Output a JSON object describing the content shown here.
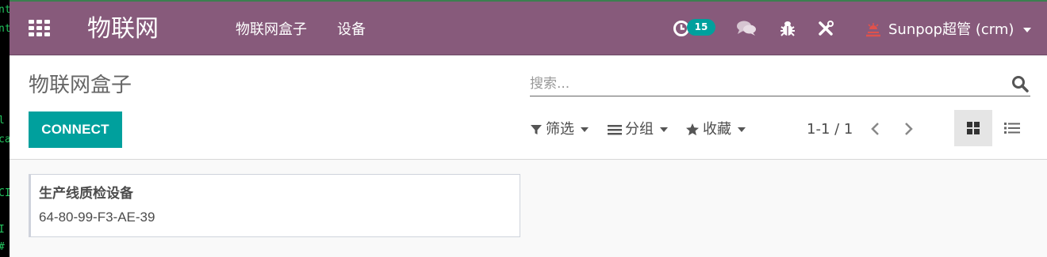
{
  "terminal": {
    "fragments": [
      "nt",
      "nt",
      "l",
      "ca",
      "CI",
      "I",
      "#"
    ]
  },
  "navbar": {
    "brand": "物联网",
    "menu": [
      {
        "label": "物联网盒子"
      },
      {
        "label": "设备"
      }
    ],
    "activity_count": "15",
    "user_name": "Sunpop超管 (crm)",
    "colors": {
      "bar": "#875a7b",
      "badge": "#00a09d"
    }
  },
  "control_panel": {
    "breadcrumb": "物联网盒子",
    "connect_label": "CONNECT",
    "search_placeholder": "搜索...",
    "filters_label": "筛选",
    "groupby_label": "分组",
    "favorites_label": "收藏",
    "pager": "1-1 / 1"
  },
  "records": [
    {
      "title": "生产线质检设备",
      "mac": "64-80-99-F3-AE-39"
    }
  ]
}
